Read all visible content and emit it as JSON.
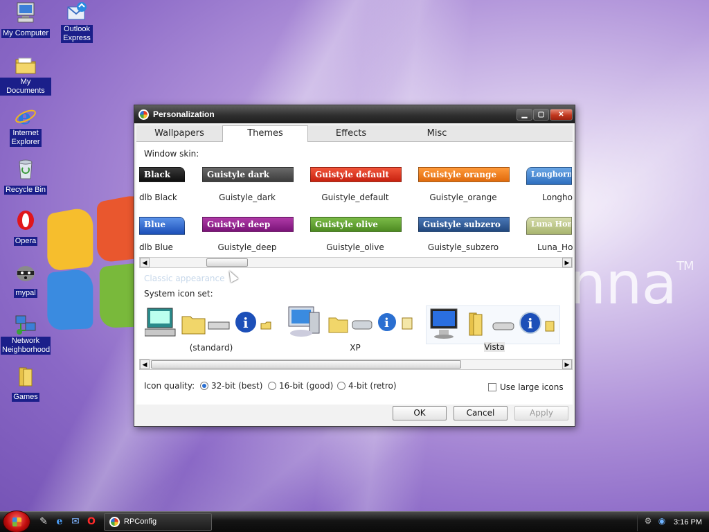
{
  "desktop": {
    "icons": [
      {
        "label": "My Computer",
        "icon": "computer-icon"
      },
      {
        "label": "Outlook Express",
        "icon": "outlook-express-icon"
      },
      {
        "label": "My Documents",
        "icon": "folder-icon"
      },
      {
        "label": "Internet Explorer",
        "icon": "internet-explorer-icon"
      },
      {
        "label": "Recycle Bin",
        "icon": "recycle-bin-icon"
      },
      {
        "label": "Opera",
        "icon": "opera-icon"
      },
      {
        "label": "mypal",
        "icon": "mypal-icon"
      },
      {
        "label": "Network Neighborhood",
        "icon": "network-icon"
      },
      {
        "label": "Games",
        "icon": "folder-icon"
      }
    ],
    "wallpaper_brand": "nna",
    "wallpaper_tm": "TM"
  },
  "window": {
    "title": "Personalization",
    "tabs": [
      "Wallpapers",
      "Themes",
      "Effects",
      "Misc"
    ],
    "active_tab": "Themes",
    "window_skin_label": "Window skin:",
    "skins": [
      {
        "preview": "Black",
        "name": "dlb Black",
        "color": "#1e1e1e"
      },
      {
        "preview": "Guistyle dark",
        "name": "Guistyle_dark",
        "color": "#4b4b4b"
      },
      {
        "preview": "Guistyle default",
        "name": "Guistyle_default",
        "color": "#e0301d"
      },
      {
        "preview": "Guistyle orange",
        "name": "Guistyle_orange",
        "color": "#f07a1a"
      },
      {
        "preview": "Longhorn",
        "name": "Longho",
        "color": "#3f86cf"
      },
      {
        "preview": "Blue",
        "name": "dlb Blue",
        "color": "#2b62c8"
      },
      {
        "preview": "Guistyle deep",
        "name": "Guistyle_deep",
        "color": "#8d1c8a"
      },
      {
        "preview": "Guistyle olive",
        "name": "Guistyle_olive",
        "color": "#5f9a2c"
      },
      {
        "preview": "Guistyle subzero",
        "name": "Guistyle_subzero",
        "color": "#2a5a9c"
      },
      {
        "preview": "Luna Home",
        "name": "Luna_Ho",
        "color": "#b9c58a"
      }
    ],
    "classic_appearance": "Classic appearance",
    "system_icon_set_label": "System icon set:",
    "icon_sets": [
      "(standard)",
      "XP",
      "Vista"
    ],
    "selected_icon_set": "Vista",
    "icon_quality_label": "Icon quality:",
    "quality_options": [
      "32-bit (best)",
      "16-bit (good)",
      "4-bit (retro)"
    ],
    "selected_quality": "32-bit (best)",
    "large_icons_label": "Use large icons",
    "large_icons_checked": false,
    "buttons": {
      "ok": "OK",
      "cancel": "Cancel",
      "apply": "Apply"
    }
  },
  "taskbar": {
    "task_item": "RPConfig",
    "clock": "3:16 PM"
  }
}
